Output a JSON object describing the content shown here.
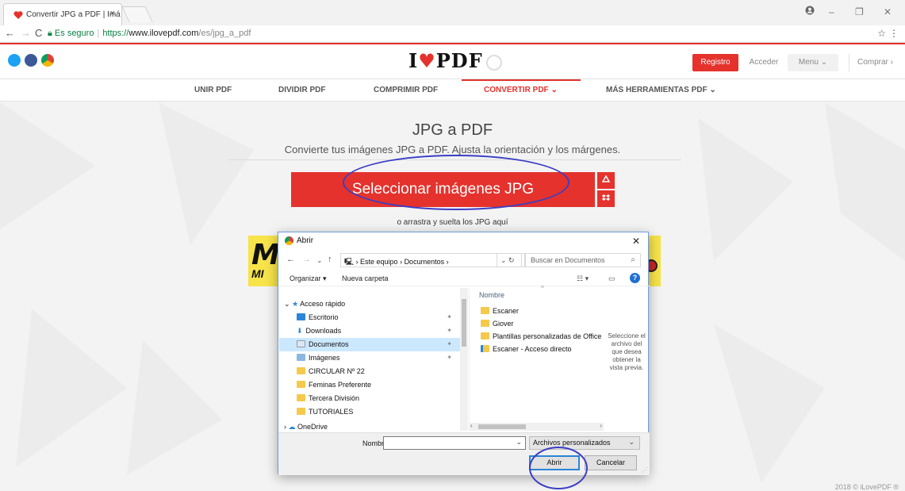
{
  "browser": {
    "tab_title": "Convertir JPG a PDF | Imá",
    "tab_close": "×",
    "secure_label": "Es seguro",
    "url_scheme": "https://",
    "url_host": "www.ilovepdf.com",
    "url_path": "/es/jpg_a_pdf"
  },
  "site": {
    "logo_left": "I",
    "logo_heart": "♥",
    "logo_right": "PDF",
    "registro": "Registro",
    "acceder": "Acceder",
    "menu": "Menu ⌄",
    "comprar": "Comprar ›",
    "nav": {
      "unir": "UNIR PDF",
      "dividir": "DIVIDIR PDF",
      "comprimir": "COMPRIMIR PDF",
      "convertir": "CONVERTIR PDF ⌄",
      "mas": "MÁS HERRAMIENTAS PDF ⌄"
    },
    "heading": "JPG a PDF",
    "subheading": "Convierte tus imágenes JPG a PDF. Ajusta la orientación y los márgenes.",
    "select_button": "Seleccionar imágenes JPG",
    "drop_hint": "o arrastra y suelta los JPG aquí",
    "ad_big": "M",
    "ad_small": "MI",
    "footer": "2018 © iLovePDF ®",
    "accent_color": "#e5322d"
  },
  "dialog": {
    "title": "Abrir",
    "path_parts": [
      "Este equipo",
      "Documentos"
    ],
    "search_placeholder": "Buscar en Documentos",
    "organizar": "Organizar ▾",
    "nueva_carpeta": "Nueva carpeta",
    "tree": [
      {
        "label": "Acceso rápido",
        "icon": "star-icon",
        "pinned": false
      },
      {
        "label": "Escritorio",
        "icon": "desktop-icon",
        "pinned": true
      },
      {
        "label": "Downloads",
        "icon": "download-icon",
        "pinned": true
      },
      {
        "label": "Documentos",
        "icon": "documents-icon",
        "pinned": true,
        "selected": true
      },
      {
        "label": "Imágenes",
        "icon": "pictures-icon",
        "pinned": true
      },
      {
        "label": "CIRCULAR Nº 22",
        "icon": "folder-icon",
        "pinned": false
      },
      {
        "label": "Feminas Preferente",
        "icon": "folder-icon",
        "pinned": false
      },
      {
        "label": "Tercera División",
        "icon": "folder-icon",
        "pinned": false
      },
      {
        "label": "TUTORIALES",
        "icon": "folder-icon",
        "pinned": false
      },
      {
        "label": "OneDrive",
        "icon": "cloud-icon",
        "pinned": false
      }
    ],
    "files_header": "Nombre",
    "files": [
      {
        "label": "Escaner",
        "icon": "folder-icon"
      },
      {
        "label": "Giover",
        "icon": "folder-icon"
      },
      {
        "label": "Plantillas personalizadas de Office",
        "icon": "folder-icon"
      },
      {
        "label": "Escaner - Acceso directo",
        "icon": "shortcut-icon"
      }
    ],
    "preview_text": "Seleccione el archivo del que desea obtener la vista previa.",
    "nombre_label": "Nombre:",
    "nombre_value": "",
    "file_type": "Archivos personalizados",
    "open_button": "Abrir",
    "cancel_button": "Cancelar"
  },
  "annotation_color": "#3b3fc4"
}
